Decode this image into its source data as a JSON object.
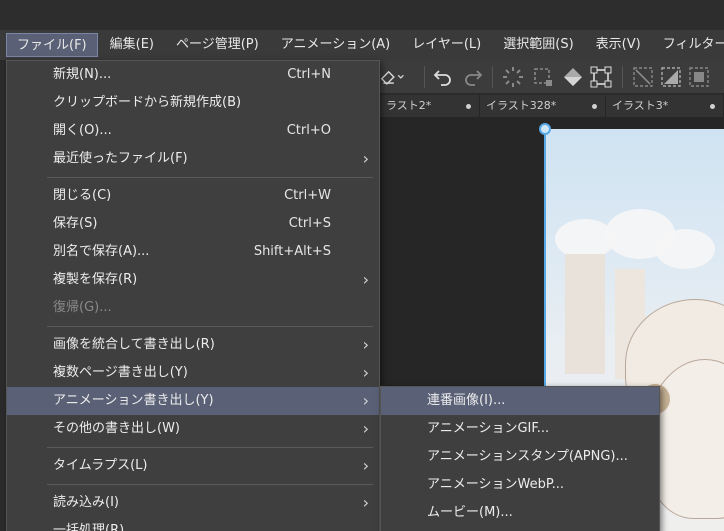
{
  "menubar": [
    {
      "label": "ファイル(F)",
      "active": true
    },
    {
      "label": "編集(E)"
    },
    {
      "label": "ページ管理(P)"
    },
    {
      "label": "アニメーション(A)"
    },
    {
      "label": "レイヤー(L)"
    },
    {
      "label": "選択範囲(S)"
    },
    {
      "label": "表示(V)"
    },
    {
      "label": "フィルター"
    }
  ],
  "tabs": [
    {
      "label": "ラスト2*"
    },
    {
      "label": "イラスト328*"
    },
    {
      "label": "イラスト3*"
    }
  ],
  "file_menu": {
    "groups": [
      [
        {
          "label": "新規(N)...",
          "shortcut": "Ctrl+N"
        },
        {
          "label": "クリップボードから新規作成(B)"
        },
        {
          "label": "開く(O)...",
          "shortcut": "Ctrl+O"
        },
        {
          "label": "最近使ったファイル(F)",
          "submenu": true
        }
      ],
      [
        {
          "label": "閉じる(C)",
          "shortcut": "Ctrl+W"
        },
        {
          "label": "保存(S)",
          "shortcut": "Ctrl+S"
        },
        {
          "label": "別名で保存(A)...",
          "shortcut": "Shift+Alt+S"
        },
        {
          "label": "複製を保存(R)",
          "submenu": true
        },
        {
          "label": "復帰(G)...",
          "disabled": true
        }
      ],
      [
        {
          "label": "画像を統合して書き出し(R)",
          "submenu": true
        },
        {
          "label": "複数ページ書き出し(Y)",
          "submenu": true
        },
        {
          "label": "アニメーション書き出し(Y)",
          "submenu": true,
          "highlighted": true
        },
        {
          "label": "その他の書き出し(W)",
          "submenu": true
        }
      ],
      [
        {
          "label": "タイムラプス(L)",
          "submenu": true
        }
      ],
      [
        {
          "label": "読み込み(I)",
          "submenu": true
        },
        {
          "label": "一括処理(R)..."
        }
      ]
    ]
  },
  "animation_export_submenu": [
    {
      "label": "連番画像(I)...",
      "highlighted": true
    },
    {
      "label": "アニメーションGIF..."
    },
    {
      "label": "アニメーションスタンプ(APNG)..."
    },
    {
      "label": "アニメーションWebP..."
    },
    {
      "label": "ムービー(M)..."
    }
  ],
  "icons": {
    "submenu_arrow": "chevron-right-icon",
    "toolbar": [
      "fill-dropdown-icon",
      "undo-icon",
      "redo-icon",
      "loading-icon",
      "select-rect-icon",
      "fill-icon",
      "transform-icon",
      "clear-icon",
      "fill-selection-icon",
      "crop-icon"
    ]
  },
  "colors": {
    "menu_bg": "#3f3f3f",
    "highlight": "#5a6176",
    "selection": "#58a8e6"
  }
}
